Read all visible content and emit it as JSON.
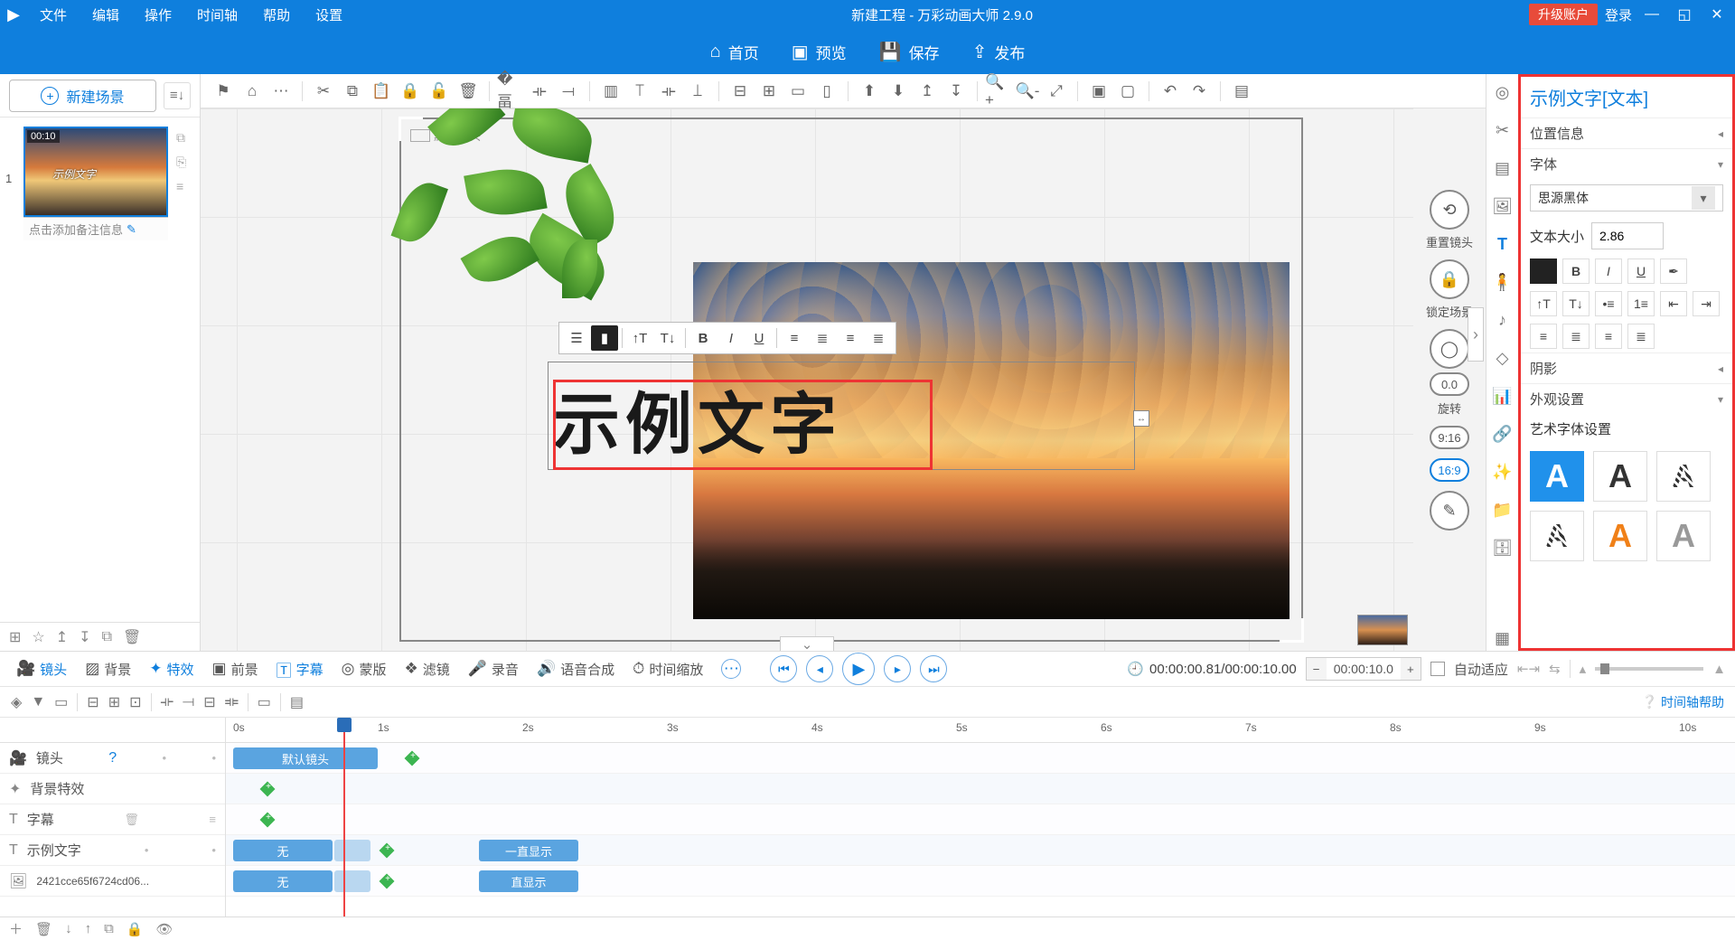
{
  "app": {
    "title": "新建工程 - 万彩动画大师 2.9.0"
  },
  "menubar": [
    "文件",
    "编辑",
    "操作",
    "时间轴",
    "帮助",
    "设置"
  ],
  "titlebar_right": {
    "upgrade": "升级账户",
    "login": "登录"
  },
  "actionbar": {
    "home": "首页",
    "preview": "预览",
    "save": "保存",
    "publish": "发布"
  },
  "left": {
    "new_scene": "新建场景",
    "scene1": {
      "num": "1",
      "duration": "00:10",
      "thumb_text": "示例文字",
      "note": "点击添加备注信息"
    }
  },
  "canvas": {
    "cam_label": "默认镜头",
    "text_sample": "示例文字",
    "rt": {
      "reset_cam": "重置镜头",
      "lock_scene": "锁定场景",
      "rotation": "旋转",
      "rot_val": "0.0",
      "ratio1": "9:16",
      "ratio2": "16:9"
    }
  },
  "props": {
    "title": "示例文字[文本]",
    "sec_position": "位置信息",
    "sec_font": "字体",
    "font_name": "思源黑体",
    "size_label": "文本大小",
    "size_value": "2.86",
    "sec_shadow": "阴影",
    "sec_appearance": "外观设置",
    "sec_artfont": "艺术字体设置"
  },
  "tl_tabs": {
    "camera": "镜头",
    "bg": "背景",
    "fx": "特效",
    "fg": "前景",
    "subtitle": "字幕",
    "mask": "蒙版",
    "filter": "滤镜",
    "record": "录音",
    "tts": "语音合成",
    "timescale": "时间缩放"
  },
  "timeline": {
    "time": "00:00:00.81/00:00:10.00",
    "dur_box": "00:00:10.0",
    "autofit": "自动适应",
    "help": "时间轴帮助",
    "ticks": [
      "0s",
      "1s",
      "2s",
      "3s",
      "4s",
      "5s",
      "6s",
      "7s",
      "8s",
      "9s",
      "10s"
    ],
    "tracks": {
      "camera": "镜头",
      "bgfx": "背景特效",
      "subtitle": "字幕",
      "text": "示例文字",
      "img": "2421cce65f6724cd06..."
    },
    "clips": {
      "default_cam": "默认镜头",
      "none": "无",
      "always_show": "一直显示",
      "show": "直显示"
    }
  }
}
